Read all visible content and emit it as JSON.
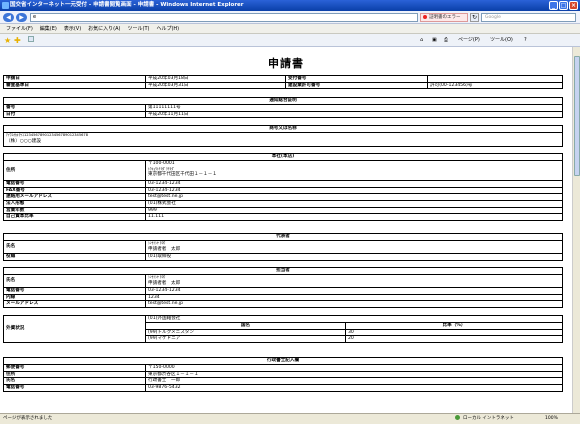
{
  "window": {
    "title": "国交省インターネット一元受付 - 申請書閲覧画面 - 申請書 - Windows Internet Explorer",
    "address": "e",
    "error_label": "証明書のエラー",
    "search_placeholder": "Google"
  },
  "menu": [
    "ファイル(F)",
    "編集(E)",
    "表示(V)",
    "お気に入り(A)",
    "ツール(T)",
    "ヘルプ(H)"
  ],
  "toolbar": {
    "page_label": "ページ(P)",
    "tools_label": "ツール(O)"
  },
  "document": {
    "title": "申請書",
    "header": {
      "application_date_label": "申請日",
      "application_date_value": "平成20年03月18日",
      "receipt_no_label": "受付番号",
      "receipt_no_value": "",
      "review_date_label": "審査基準日",
      "review_date_value": "平成20年03月31日",
      "license_no_label": "建設業許可番号",
      "license_no_value": "許可(00-123456)号"
    },
    "certificate": {
      "heading": "通知総合証明",
      "number_label": "番号",
      "number_value": "第11111111号",
      "date_label": "日付",
      "date_value": "平成20年11月11日"
    },
    "trade_name": {
      "heading": "商号又は名称",
      "kana": "ｱｲｳｴｵｶｷｸｹｺ1234567890123456789012345678",
      "name": "（株）○○○建設"
    },
    "head_office": {
      "heading": "本社(本店)",
      "address_label": "住所",
      "postal": "〒100-0001",
      "address_kana": "ﾄｳｷｮｳﾄﾁﾖﾀﾞｸﾁﾖﾀﾞ",
      "address": "東京都千代田区千代田１－１－１",
      "phone_label": "電話番号",
      "phone_value": "03-1234-1234",
      "fax_label": "FAX番号",
      "fax_value": "03-1234-1234",
      "email_label": "連絡用メールアドレス",
      "email_value": "test@test.ne.jp",
      "form_label": "法人形態",
      "form_value": "(01)株式会社",
      "years_label": "営業年数",
      "years_value": "999",
      "ratio_label": "自己資本比率",
      "ratio_value": "11.111"
    },
    "representative": {
      "heading": "代表者",
      "name_label": "氏名",
      "name_kana": "ｼﾝｾｲｼﾔ ﾀﾛｳ",
      "name": "申請者者　太郎",
      "title_label": "役職",
      "title_value": "(01)取締役"
    },
    "contact": {
      "heading": "担当者",
      "name_label": "氏名",
      "name_kana": "ｼﾝｾｲｼﾔ ﾀﾛｳ",
      "name": "申請者者　太郎",
      "phone_label": "電話番号",
      "phone_value": "03-1234-1234",
      "ext_label": "内線",
      "ext_value": "1234",
      "email_label": "メールアドレス",
      "email_value": "test@test.ne.jp"
    },
    "capital": {
      "label": "外資状況",
      "status": "(01)外国籍会社",
      "country_header": "国名",
      "ratio_header": "比率（%）",
      "rows": [
        {
          "country": "(99)トルクメニスタン",
          "ratio": "30"
        },
        {
          "country": "(99)マケドニア",
          "ratio": "20"
        }
      ]
    },
    "scrivener": {
      "heading": "行政書士記入欄",
      "postal_label": "郵便番号",
      "postal_value": "〒150-0000",
      "address_label": "住所",
      "address_value": "東京都渋谷区１－１－１",
      "name_label": "氏名",
      "name_value": "行政書士　一郎",
      "phone_label": "電話番号",
      "phone_value": "03-9876-5432"
    }
  },
  "status": {
    "message": "ページが表示されました",
    "zone": "ローカル イントラネット",
    "zoom": "100%"
  }
}
